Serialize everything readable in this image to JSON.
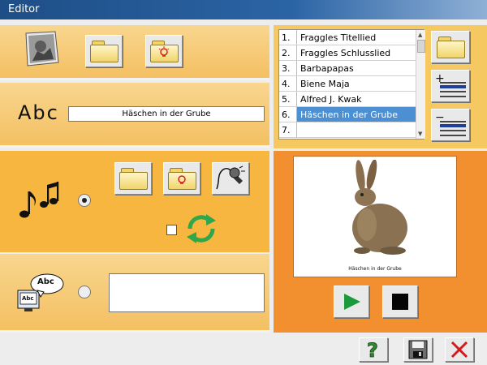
{
  "window": {
    "title": "Editor"
  },
  "text_panel": {
    "abc_label": "Abc",
    "title_value": "Häschen in der Grube"
  },
  "playlist": {
    "items": [
      {
        "num": "1.",
        "title": "Fraggles Titellied"
      },
      {
        "num": "2.",
        "title": "Fraggles Schlusslied"
      },
      {
        "num": "3.",
        "title": "Barbapapas"
      },
      {
        "num": "4.",
        "title": "Biene Maja"
      },
      {
        "num": "5.",
        "title": "Alfred J. Kwak"
      },
      {
        "num": "6.",
        "title": "Häschen in der Grube"
      },
      {
        "num": "7.",
        "title": ""
      }
    ],
    "selected_index": 5
  },
  "preview": {
    "caption": "Häschen in der Grube"
  },
  "speech": {
    "bubble_text": "Abc",
    "monitor_text": "Abc",
    "text_value": ""
  },
  "icons": {
    "photo": "photo-icon",
    "open_folder": "folder-icon",
    "idea_folder": "idea-folder-icon",
    "add_item": "list-add-icon",
    "remove_item": "list-remove-icon",
    "music": "music-notes-icon",
    "record": "microphone-icon",
    "repeat": "repeat-icon",
    "play": "play-icon",
    "stop": "stop-icon",
    "help": "help-icon",
    "save": "save-icon",
    "close": "close-icon"
  },
  "colors": {
    "title_bar": "#2b64a5",
    "panel_light": "#f6c862",
    "panel_orange": "#f28f2e",
    "selection": "#4c8fd3",
    "repeat_green": "#2ea84a",
    "play_green": "#1a9a3a",
    "close_red": "#d6181b",
    "help_green": "#2e8b2e"
  }
}
